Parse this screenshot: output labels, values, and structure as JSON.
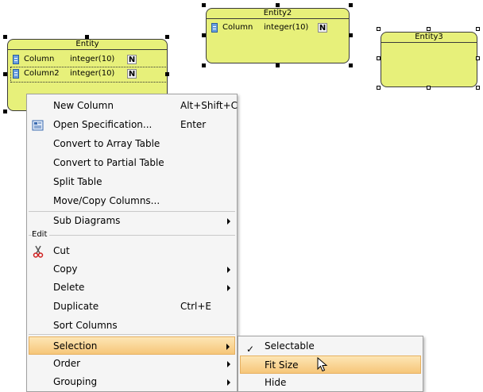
{
  "entities": [
    {
      "title": "Entity",
      "columns": [
        {
          "name": "Column",
          "type": "integer(10)",
          "nullable": "N"
        },
        {
          "name": "Column2",
          "type": "integer(10)",
          "nullable": "N"
        }
      ]
    },
    {
      "title": "Entity2",
      "columns": [
        {
          "name": "Column",
          "type": "integer(10)",
          "nullable": "N"
        }
      ]
    },
    {
      "title": "Entity3",
      "columns": []
    }
  ],
  "context_menu": {
    "items": [
      {
        "label": "New Column",
        "accel": "Alt+Shift+C"
      },
      {
        "label": "Open Specification...",
        "accel": "Enter",
        "icon": "specification-icon"
      },
      {
        "label": "Convert to Array Table"
      },
      {
        "label": "Convert to Partial Table"
      },
      {
        "label": "Split Table"
      },
      {
        "label": "Move/Copy Columns..."
      }
    ],
    "sub_diagrams": {
      "label": "Sub Diagrams"
    },
    "edit_section": "Edit",
    "edit_items": [
      {
        "label": "Cut",
        "icon": "scissors-icon"
      },
      {
        "label": "Copy"
      },
      {
        "label": "Delete"
      },
      {
        "label": "Duplicate",
        "accel": "Ctrl+E"
      },
      {
        "label": "Sort Columns"
      }
    ],
    "more_items": [
      {
        "label": "Selection",
        "highlighted": true
      },
      {
        "label": "Order"
      },
      {
        "label": "Grouping"
      }
    ]
  },
  "submenu": {
    "items": [
      {
        "label": "Selectable",
        "checked": true
      },
      {
        "label": "Fit Size",
        "highlighted": true
      },
      {
        "label": "Hide"
      }
    ]
  },
  "colors": {
    "entity_fill": "#e7f07a",
    "highlight": "#f6c679"
  }
}
